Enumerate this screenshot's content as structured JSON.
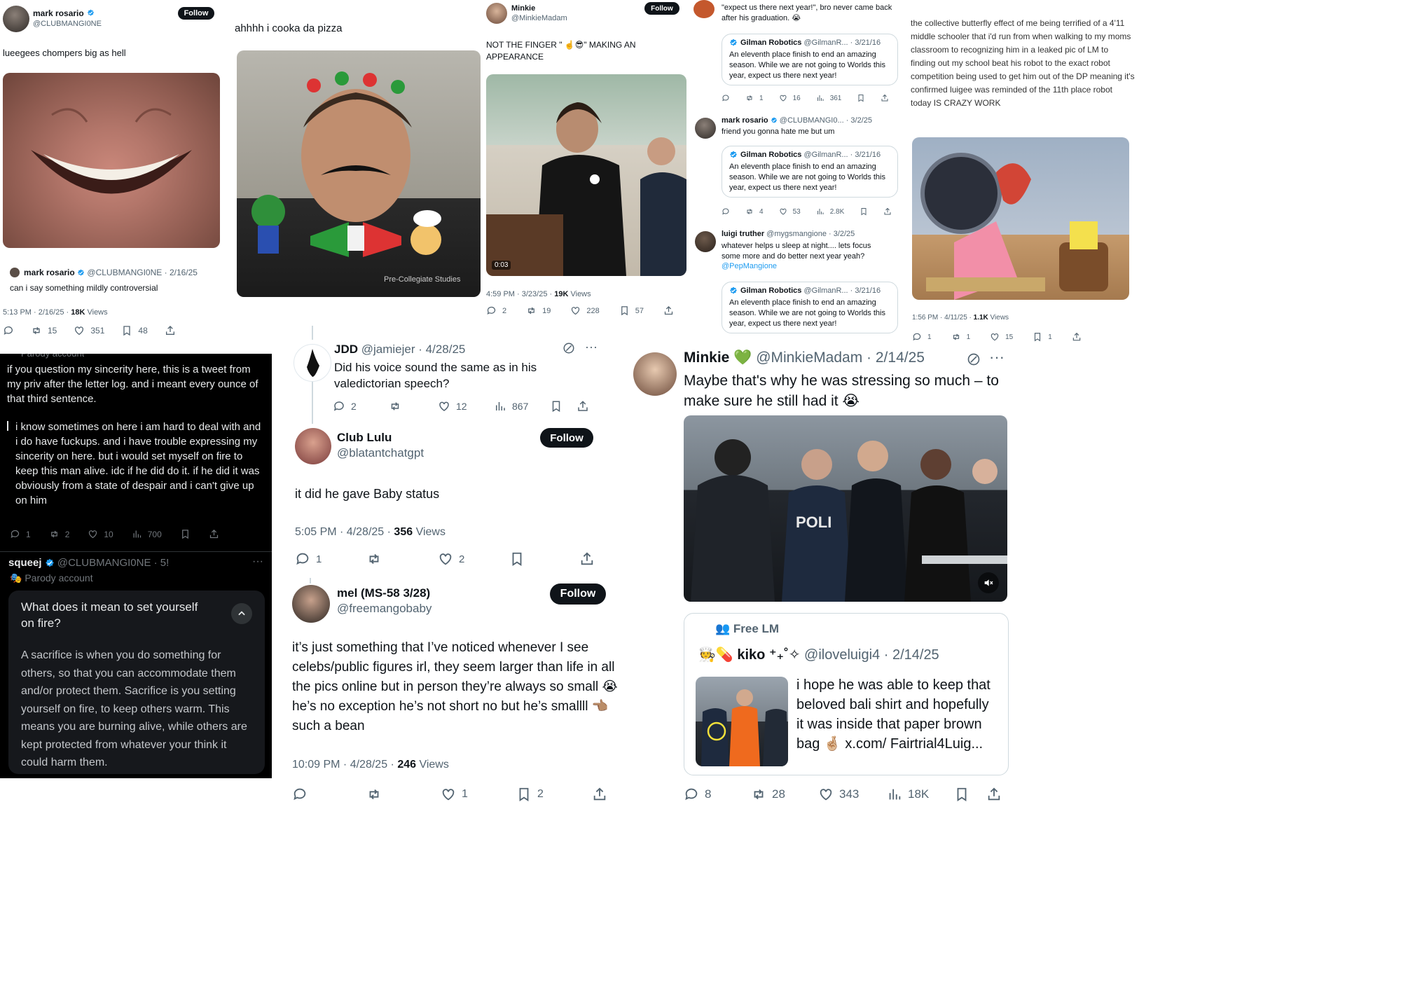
{
  "colors": {
    "brand": "#1d9bf0",
    "text": "#0f1419",
    "muted": "#536471",
    "follow_bg": "#0f1419",
    "dark_bg": "#000000",
    "link": "#1d9bf0"
  },
  "t1": {
    "name": "mark rosario",
    "handle": "@CLUBMANGI0NE",
    "follow": "Follow",
    "text": "lueegees chompers big as hell",
    "quote": {
      "name": "mark rosario",
      "handle": "@CLUBMANGI0NE",
      "date": "· 2/16/25",
      "text": "can i say something mildly controversial"
    },
    "time": "5:13 PM · 2/16/25 ·",
    "views": "18K",
    "views_label": "Views",
    "retweets": "15",
    "likes": "351",
    "bookmarks": "48"
  },
  "t2": {
    "text": "ahhhh i cooka da pizza",
    "img_text": "Pre-Collegiate Studies"
  },
  "t3": {
    "name": "Minkie",
    "handle": "@MinkieMadam",
    "follow": "Follow",
    "text": "NOT THE FINGER \" ☝️😎\" MAKING AN APPEARANCE",
    "video_time": "0:03",
    "time": "4:59 PM · 3/23/25 ·",
    "views": "19K",
    "views_label": "Views",
    "replies": "2",
    "retweets": "19",
    "likes": "228",
    "bookmarks": "57"
  },
  "t4": {
    "top_text": "\"expect us there next year!\", bro never came back after his graduation. 😭",
    "quote_name": "Gilman Robotics",
    "quote_handle": "@GilmanR... · 3/21/16",
    "quote_text": "An eleventh place finish to end an amazing season. While we are not going to Worlds this year, expect us there next year!",
    "a1": {
      "retweets": "1",
      "likes": "16",
      "views": "361"
    },
    "reply1": {
      "name": "mark rosario",
      "handle": "@CLUBMANGI0... · 3/2/25",
      "text": "friend you gonna hate me but um"
    },
    "a2": {
      "retweets": "4",
      "likes": "53",
      "views": "2.8K"
    },
    "reply2": {
      "name": "luigi truther",
      "handle": "@mygsmangione · 3/2/25",
      "text": "whatever helps u sleep at night.... lets focus some more and do better next year yeah?",
      "link": "@PepMangione"
    }
  },
  "t5": {
    "text": "the collective butterfly effect of me being terrified of a 4'11 middle schooler that i'd run from when walking to my moms classroom to recognizing him in a leaked pic of LM to finding out my school beat his robot to the exact robot competition being used to get him out of the DP meaning it's confirmed luigee was reminded of the 11th place robot today IS CRAZY WORK",
    "time": "1:56 PM · 4/11/25 ·",
    "views": "1.1K",
    "views_label": "Views",
    "replies": "1",
    "retweets": "1",
    "likes": "15",
    "bookmarks": "1"
  },
  "t6": {
    "label": "Parody account",
    "text1": "if you question my sincerity here, this is a tweet from my priv after the letter log. and i meant every ounce of that third sentence.",
    "text2": "i know sometimes on here i am hard to deal with and i do have fuckups. and i have trouble expressing my sincerity on here. but i would set myself on fire to keep this man alive. idc if he did do it. if he did it was obviously from a state of despair and i can't give up on him",
    "replies": "1",
    "retweets": "2",
    "likes": "10",
    "views": "700",
    "name": "squeej",
    "handle": "@CLUBMANGI0NE · 5!",
    "parody": "Parody account",
    "grok_q": "What does it mean to set yourself on fire?",
    "grok_a": "A sacrifice is when you do something for others, so that you can accommodate them and/or protect them. Sacrifice is you setting yourself on fire, to keep others warm. This means you are burning alive, while others are kept protected from whatever your think it could harm them."
  },
  "t7": {
    "name": "JDD",
    "handle": "@jamiejer",
    "date": "· 4/28/25",
    "text": "Did his voice sound the same as in his valedictorian speech?",
    "replies": "2",
    "likes": "12",
    "views": "867"
  },
  "t8": {
    "name": "Club Lulu",
    "handle": "@blatantchatgpt",
    "follow": "Follow",
    "text": "it did he gave Baby status",
    "time": "5:05 PM · 4/28/25 ·",
    "views": "356",
    "views_label": "Views",
    "replies": "1",
    "likes": "2"
  },
  "t9": {
    "name": "mel (MS-58 3/28)",
    "handle": "@freemangobaby",
    "follow": "Follow",
    "text": "it’s just something that I’ve noticed whenever I see celebs/public figures irl, they seem larger than life in all the pics online but in person they’re always so small 😭 he’s no exception he’s not short no but he’s smallll 👈🏽 such a bean",
    "time": "10:09 PM · 4/28/25 ·",
    "views": "246",
    "views_label": "Views",
    "likes": "1",
    "bookmarks": "2"
  },
  "t10": {
    "name": "Minkie 💚",
    "handle": "@MinkieMadam · 2/14/25",
    "text": "Maybe that's why he was stressing so much – to make sure he still had it 😭",
    "img_text": "POLI",
    "community": "Free LM",
    "quote_name": "kiko ⁺₊˚✧",
    "quote_handle": "@iloveluigi4 · 2/14/25",
    "quote_text": "i hope he was able to keep that beloved bali shirt and hopefully it was inside that paper brown bag 🤞🏼 x.com/ Fairtrial4Luig...",
    "replies": "8",
    "retweets": "28",
    "likes": "343",
    "views": "18K"
  }
}
